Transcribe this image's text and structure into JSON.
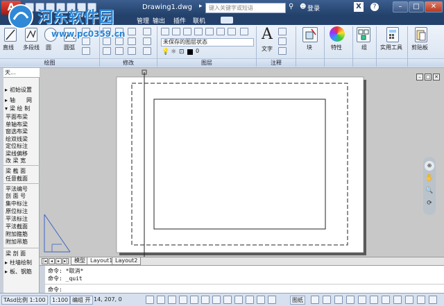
{
  "window": {
    "title": "Drawing1.dwg",
    "logo_text": "A",
    "search_placeholder": "键入关键字或短语",
    "login_label": "登录",
    "exchange_label": "X",
    "help_label": "?",
    "minimize": "–",
    "maximize": "□",
    "close": "✕"
  },
  "menu_tabs": [
    "常用",
    "插入",
    "注释",
    "管理",
    "输出",
    "插件",
    "联机"
  ],
  "ribbon": {
    "draw": {
      "label": "绘图",
      "buttons": [
        "直线",
        "多段线",
        "圆",
        "圆弧"
      ]
    },
    "modify": {
      "label": "修改"
    },
    "layers": {
      "label": "图层",
      "state_dropdown": "未保存的图层状态",
      "current_layer": "0"
    },
    "annotation": {
      "label": "注释",
      "text_button": "文字"
    },
    "block": {
      "label": "块"
    },
    "properties": {
      "label": "特性"
    },
    "groups": {
      "label": "组"
    },
    "utilities": {
      "label": "实用工具"
    },
    "clipboard": {
      "label": "剪贴板"
    }
  },
  "watermark": {
    "site_name": "河东软件园",
    "url": "www.pc0359.cn"
  },
  "palette": {
    "header": "天...",
    "items": [
      {
        "label": "初始设置",
        "arrow": "▸"
      },
      {
        "label": "轴　　网",
        "arrow": "▸"
      },
      {
        "label": "梁 绘 制",
        "arrow": "▾"
      }
    ],
    "beam_tools": [
      "平面布梁",
      "单轴布梁",
      "窗选布梁",
      "绘双线梁",
      "定位标注",
      "梁线偏移",
      "改 梁 宽"
    ],
    "section_tools": [
      "梁 截 面",
      "任意截面"
    ],
    "label_tools": [
      "平法编号",
      "剖 面 号",
      "集中标注",
      "原位标注",
      "平法标注",
      "平法截面",
      "附加箍筋",
      "附加吊筋"
    ],
    "bottom_items": [
      {
        "label": "梁 剖 面",
        "arrow": ""
      },
      {
        "label": "柱墙绘制",
        "arrow": "▸"
      },
      {
        "label": "板、钢筋",
        "arrow": "▸"
      }
    ]
  },
  "viewport_controls": [
    "–",
    "□",
    "✕"
  ],
  "layout_tabs": [
    "模型",
    "Layout1",
    "Layout2"
  ],
  "command": {
    "history": [
      "命令: *取消*",
      "命令: _quit"
    ],
    "prompt": "命令:"
  },
  "statusbar": {
    "scale": "TAsd比例 1:100",
    "scale2": "1:100",
    "mode": "编组 开",
    "coords": "14,  207, 0",
    "model_label": "图纸"
  },
  "colors": {
    "title_bg": "#23416b",
    "ribbon_bg": "#d6e2f1",
    "canvas_bg": "#c8c8c8",
    "paper_bg": "#ffffff"
  }
}
